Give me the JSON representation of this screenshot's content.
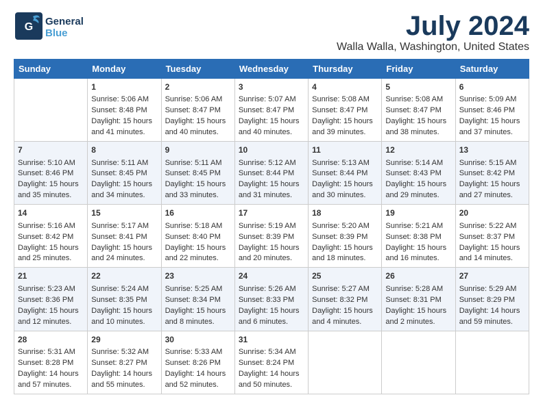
{
  "logo": {
    "general": "General",
    "blue": "Blue"
  },
  "header": {
    "title": "July 2024",
    "subtitle": "Walla Walla, Washington, United States"
  },
  "calendar": {
    "weekdays": [
      "Sunday",
      "Monday",
      "Tuesday",
      "Wednesday",
      "Thursday",
      "Friday",
      "Saturday"
    ],
    "weeks": [
      [
        {
          "day": "",
          "content": ""
        },
        {
          "day": "1",
          "content": "Sunrise: 5:06 AM\nSunset: 8:48 PM\nDaylight: 15 hours\nand 41 minutes."
        },
        {
          "day": "2",
          "content": "Sunrise: 5:06 AM\nSunset: 8:47 PM\nDaylight: 15 hours\nand 40 minutes."
        },
        {
          "day": "3",
          "content": "Sunrise: 5:07 AM\nSunset: 8:47 PM\nDaylight: 15 hours\nand 40 minutes."
        },
        {
          "day": "4",
          "content": "Sunrise: 5:08 AM\nSunset: 8:47 PM\nDaylight: 15 hours\nand 39 minutes."
        },
        {
          "day": "5",
          "content": "Sunrise: 5:08 AM\nSunset: 8:47 PM\nDaylight: 15 hours\nand 38 minutes."
        },
        {
          "day": "6",
          "content": "Sunrise: 5:09 AM\nSunset: 8:46 PM\nDaylight: 15 hours\nand 37 minutes."
        }
      ],
      [
        {
          "day": "7",
          "content": "Sunrise: 5:10 AM\nSunset: 8:46 PM\nDaylight: 15 hours\nand 35 minutes."
        },
        {
          "day": "8",
          "content": "Sunrise: 5:11 AM\nSunset: 8:45 PM\nDaylight: 15 hours\nand 34 minutes."
        },
        {
          "day": "9",
          "content": "Sunrise: 5:11 AM\nSunset: 8:45 PM\nDaylight: 15 hours\nand 33 minutes."
        },
        {
          "day": "10",
          "content": "Sunrise: 5:12 AM\nSunset: 8:44 PM\nDaylight: 15 hours\nand 31 minutes."
        },
        {
          "day": "11",
          "content": "Sunrise: 5:13 AM\nSunset: 8:44 PM\nDaylight: 15 hours\nand 30 minutes."
        },
        {
          "day": "12",
          "content": "Sunrise: 5:14 AM\nSunset: 8:43 PM\nDaylight: 15 hours\nand 29 minutes."
        },
        {
          "day": "13",
          "content": "Sunrise: 5:15 AM\nSunset: 8:42 PM\nDaylight: 15 hours\nand 27 minutes."
        }
      ],
      [
        {
          "day": "14",
          "content": "Sunrise: 5:16 AM\nSunset: 8:42 PM\nDaylight: 15 hours\nand 25 minutes."
        },
        {
          "day": "15",
          "content": "Sunrise: 5:17 AM\nSunset: 8:41 PM\nDaylight: 15 hours\nand 24 minutes."
        },
        {
          "day": "16",
          "content": "Sunrise: 5:18 AM\nSunset: 8:40 PM\nDaylight: 15 hours\nand 22 minutes."
        },
        {
          "day": "17",
          "content": "Sunrise: 5:19 AM\nSunset: 8:39 PM\nDaylight: 15 hours\nand 20 minutes."
        },
        {
          "day": "18",
          "content": "Sunrise: 5:20 AM\nSunset: 8:39 PM\nDaylight: 15 hours\nand 18 minutes."
        },
        {
          "day": "19",
          "content": "Sunrise: 5:21 AM\nSunset: 8:38 PM\nDaylight: 15 hours\nand 16 minutes."
        },
        {
          "day": "20",
          "content": "Sunrise: 5:22 AM\nSunset: 8:37 PM\nDaylight: 15 hours\nand 14 minutes."
        }
      ],
      [
        {
          "day": "21",
          "content": "Sunrise: 5:23 AM\nSunset: 8:36 PM\nDaylight: 15 hours\nand 12 minutes."
        },
        {
          "day": "22",
          "content": "Sunrise: 5:24 AM\nSunset: 8:35 PM\nDaylight: 15 hours\nand 10 minutes."
        },
        {
          "day": "23",
          "content": "Sunrise: 5:25 AM\nSunset: 8:34 PM\nDaylight: 15 hours\nand 8 minutes."
        },
        {
          "day": "24",
          "content": "Sunrise: 5:26 AM\nSunset: 8:33 PM\nDaylight: 15 hours\nand 6 minutes."
        },
        {
          "day": "25",
          "content": "Sunrise: 5:27 AM\nSunset: 8:32 PM\nDaylight: 15 hours\nand 4 minutes."
        },
        {
          "day": "26",
          "content": "Sunrise: 5:28 AM\nSunset: 8:31 PM\nDaylight: 15 hours\nand 2 minutes."
        },
        {
          "day": "27",
          "content": "Sunrise: 5:29 AM\nSunset: 8:29 PM\nDaylight: 14 hours\nand 59 minutes."
        }
      ],
      [
        {
          "day": "28",
          "content": "Sunrise: 5:31 AM\nSunset: 8:28 PM\nDaylight: 14 hours\nand 57 minutes."
        },
        {
          "day": "29",
          "content": "Sunrise: 5:32 AM\nSunset: 8:27 PM\nDaylight: 14 hours\nand 55 minutes."
        },
        {
          "day": "30",
          "content": "Sunrise: 5:33 AM\nSunset: 8:26 PM\nDaylight: 14 hours\nand 52 minutes."
        },
        {
          "day": "31",
          "content": "Sunrise: 5:34 AM\nSunset: 8:24 PM\nDaylight: 14 hours\nand 50 minutes."
        },
        {
          "day": "",
          "content": ""
        },
        {
          "day": "",
          "content": ""
        },
        {
          "day": "",
          "content": ""
        }
      ]
    ]
  }
}
